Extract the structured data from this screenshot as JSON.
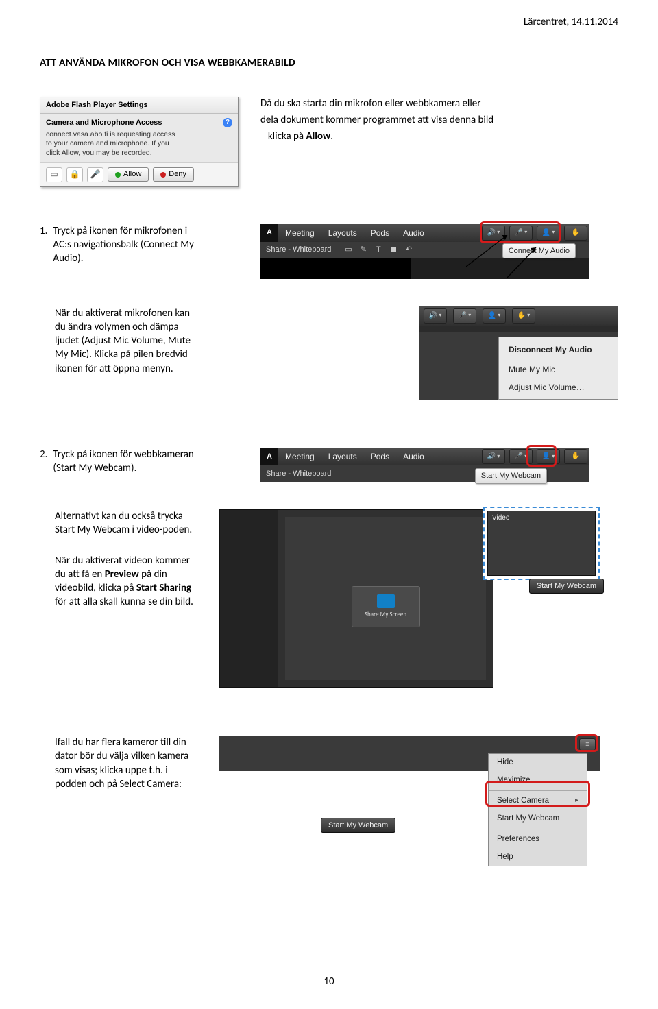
{
  "header": {
    "right": "Lärcentret, 14.11.2014"
  },
  "title_main": "ATT ANVÄNDA MIKROFON OCH VISA WEBBKAMERABILD",
  "intro": {
    "line1": "Då du ska starta din mikrofon eller webbkamera eller",
    "line2": "dela dokument kommer programmet att visa denna bild",
    "line3_pre": "– klicka på ",
    "line3_bold": "Allow",
    "line3_post": "."
  },
  "flash": {
    "title": "Adobe Flash Player Settings",
    "subtitle": "Camera and Microphone Access",
    "body_line1": "connect.vasa.abo.fi is requesting access",
    "body_line2": "to your camera and microphone. If you",
    "body_line3": "click Allow, you may be recorded.",
    "allow": "Allow",
    "deny": "Deny"
  },
  "step1": {
    "num": "1.",
    "text_a": "Tryck på ikonen för mikrofonen i",
    "text_b": "AC:s navigationsbalk (Connect My",
    "text_c": "Audio)."
  },
  "ac_nav": {
    "menu": [
      "Meeting",
      "Layouts",
      "Pods",
      "Audio"
    ],
    "share_label": "Share - Whiteboard",
    "tooltip_connect_audio": "Connect My Audio",
    "tooltip_start_webcam": "Start My Webcam"
  },
  "mic_paragraph": {
    "a": "När du aktiverat mikrofonen kan",
    "b": "du ändra volymen och dämpa",
    "c": "ljudet (Adjust Mic Volume, Mute",
    "d": "My Mic). Klicka på pilen bredvid",
    "e": "ikonen för att öppna menyn."
  },
  "mic_menu": {
    "title": "Disconnect My Audio",
    "item1": "Mute My Mic",
    "item2": "Adjust Mic Volume…"
  },
  "step2": {
    "num": "2.",
    "text_a": "Tryck på ikonen för webbkameran",
    "text_b": "(Start My Webcam)."
  },
  "alt_text": {
    "a": "Alternativt kan du också trycka",
    "b": "Start My Webcam i video-poden."
  },
  "preview_text": {
    "a": "När du aktiverat videon kommer",
    "b_pre": "du att få en ",
    "b_bold": "Preview",
    "b_post": " på din",
    "c_pre": "videobild, klicka på ",
    "c_bold": "Start Sharing",
    "d": "för att alla skall kunna se din bild."
  },
  "video_pod": {
    "title": "Video",
    "share_btn": "Share My Screen",
    "start_btn": "Start My Webcam"
  },
  "camsel_text": {
    "a": "Ifall du har flera kameror till din",
    "b": "dator bör du välja vilken kamera",
    "c": "som visas; klicka uppe t.h. i",
    "d": "podden och på Select Camera:"
  },
  "camsel_menu": {
    "hide": "Hide",
    "max": "Maximize",
    "select": "Select Camera",
    "start": "Start My Webcam",
    "prefs": "Preferences",
    "help": "Help"
  },
  "page_number": "10"
}
